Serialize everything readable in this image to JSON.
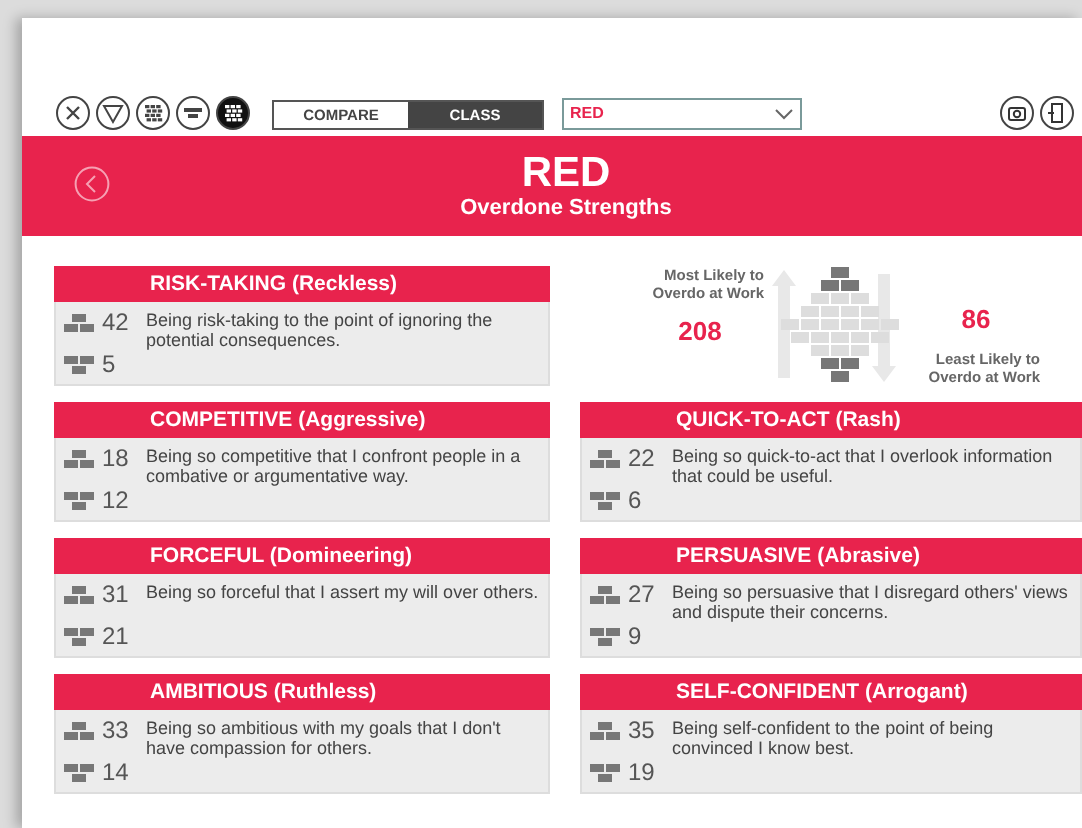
{
  "toolbar": {
    "view_icons": [
      {
        "kind": "expand",
        "selected": false
      },
      {
        "kind": "triangle",
        "selected": false
      },
      {
        "kind": "grid",
        "selected": false
      },
      {
        "kind": "bricks",
        "selected": false
      },
      {
        "kind": "grid",
        "selected": true
      }
    ],
    "mode_tabs": [
      {
        "label": "COMPARE",
        "selected": false
      },
      {
        "label": "CLASS",
        "selected": true
      }
    ],
    "class_dropdown": {
      "value": "RED"
    }
  },
  "header": {
    "title": "RED",
    "subtitle": "Overdone Strengths"
  },
  "legend": {
    "most_label": "Most Likely to Overdo at Work",
    "most_count": "208",
    "least_count": "86",
    "least_label": "Least Likely to Overdo at Work"
  },
  "cards": [
    {
      "title": "RISK-TAKING (Reckless)",
      "most": "42",
      "least": "5",
      "description": "Being risk-taking to the point of ignoring the potential consequences."
    },
    {
      "title": "COMPETITIVE (Aggressive)",
      "most": "18",
      "least": "12",
      "description": "Being so competitive that I confront people in a combative or argumentative way."
    },
    {
      "title": "QUICK-TO-ACT (Rash)",
      "most": "22",
      "least": "6",
      "description": "Being so quick-to-act that I overlook information that could be useful."
    },
    {
      "title": "FORCEFUL (Domineering)",
      "most": "31",
      "least": "21",
      "description": "Being so forceful that I assert my will over others."
    },
    {
      "title": "PERSUASIVE (Abrasive)",
      "most": "27",
      "least": "9",
      "description": "Being so persuasive that I disregard others' views and dispute their concerns."
    },
    {
      "title": "AMBITIOUS (Ruthless)",
      "most": "33",
      "least": "14",
      "description": "Being so ambitious with my goals that I don't have compassion for others."
    },
    {
      "title": "SELF-CONFIDENT (Arrogant)",
      "most": "35",
      "least": "19",
      "description": "Being self-confident to the point of being convinced I know best."
    }
  ]
}
